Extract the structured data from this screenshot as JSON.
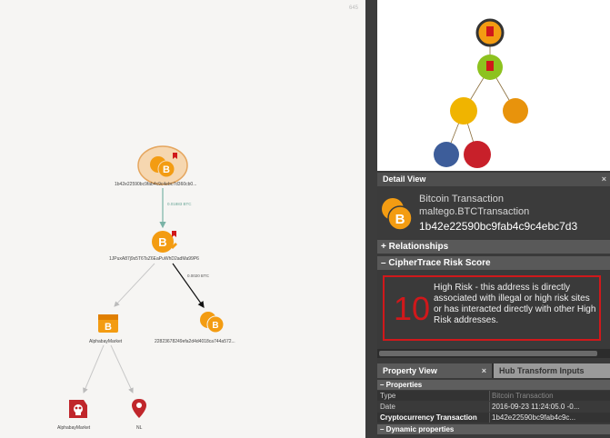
{
  "graph": {
    "corner_label": "645",
    "nodes": {
      "root": {
        "label": "1b42e22590bc9fab4c9c4ebc7d360cb0..."
      },
      "address": {
        "label": "1JPuxA87j9s5T6TsZ6EaPuWhD2adMa99P6"
      },
      "market": {
        "label": "AlphabayMarket"
      },
      "tx2": {
        "label": "22823678249efa2d4d4018ca744a572..."
      },
      "market2": {
        "label": "AlphabayMarket"
      },
      "location": {
        "label": "NL"
      }
    },
    "edges": {
      "root_to_address": "0.01883 BTC",
      "address_to_tx2": "0.0020 BTC"
    }
  },
  "detail_view": {
    "title": "Detail View",
    "close": "×",
    "entity_title": "Bitcoin Transaction",
    "entity_type": "maltego.BTCTransaction",
    "entity_value": "1b42e22590bc9fab4c9c4ebc7d3",
    "relationships_label": "+ Relationships",
    "ciphertrace_label": "– CipherTrace Risk Score",
    "risk_score": "10",
    "risk_text": "High Risk - this address is directly associated with illegal or high risk sites or has interacted directly with other High Risk addresses."
  },
  "bottom_panel": {
    "tabs": [
      "Property View",
      "Hub Transform Inputs"
    ],
    "tab_close": "×",
    "properties_header": "– Properties",
    "properties": [
      {
        "key": "Type",
        "value": "Bitcoin Transaction",
        "dim": true
      },
      {
        "key": "Date",
        "value": "2016-09-23 11:24:05.0 -0..."
      },
      {
        "key": "Cryptocurrency Transaction",
        "value": "1b42e22590bc9fab4c9c..."
      }
    ],
    "dynamic_header": "– Dynamic properties"
  },
  "colors": {
    "bitcoin_orange": "#f39c12",
    "risk_red": "#d0181b",
    "overview_green": "#8dc21f",
    "overview_yellow": "#f0b400",
    "overview_orange": "#e8930c",
    "overview_blue": "#3d5d9a",
    "overview_red": "#c8202a"
  }
}
